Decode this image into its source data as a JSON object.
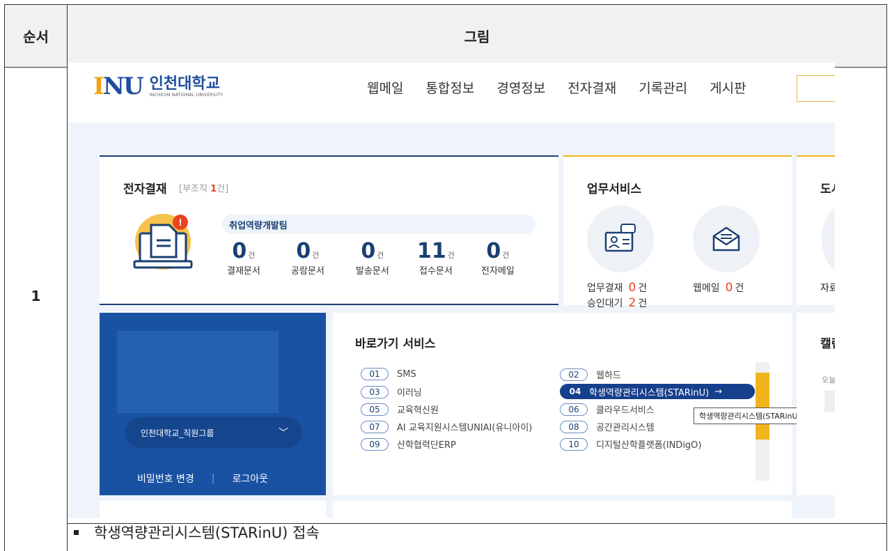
{
  "doc": {
    "header_order": "순서",
    "header_figure": "그림",
    "row_number": "1",
    "caption": "학생역량관리시스템(STARinU) 접속"
  },
  "site": {
    "logo_mark": "INU",
    "logo_ko": "인천대학교",
    "logo_en": "INCHEON NATIONAL UNIVERSITY",
    "nav": [
      "웹메일",
      "통합정보",
      "경영정보",
      "전자결재",
      "기록관리",
      "게시판"
    ]
  },
  "approval": {
    "title": "전자결재",
    "sub_prefix": "[부조직 ",
    "sub_count": "1",
    "sub_suffix": "건]",
    "team": "취업역량개발팀",
    "unit": "건",
    "stats": [
      {
        "value": "0",
        "label": "결재문서"
      },
      {
        "value": "0",
        "label": "공람문서"
      },
      {
        "value": "0",
        "label": "발송문서"
      },
      {
        "value": "11",
        "label": "접수문서"
      },
      {
        "value": "0",
        "label": "전자메일"
      }
    ]
  },
  "biz": {
    "title": "업무서비스",
    "line1_label": "업무결재",
    "line1_value": "0",
    "line2_label": "승인대기",
    "line2_value": "2",
    "mail_label": "웹메일",
    "mail_value": "0",
    "unit": "건"
  },
  "library": {
    "title": "도서",
    "label": "자료"
  },
  "user": {
    "group": "인천대학교_직원그룹",
    "change_pw": "비밀번호 변경",
    "logout": "로그아웃"
  },
  "quick": {
    "title": "바로가기 서비스",
    "items": [
      {
        "num": "01",
        "label": "SMS"
      },
      {
        "num": "02",
        "label": "웹하드"
      },
      {
        "num": "03",
        "label": "이러닝"
      },
      {
        "num": "04",
        "label": "학생역량관리시스템(STARinU)"
      },
      {
        "num": "05",
        "label": "교육혁신원"
      },
      {
        "num": "06",
        "label": "클라우드서비스"
      },
      {
        "num": "07",
        "label": "AI 교육지원시스템UNIAI(유니아이)"
      },
      {
        "num": "08",
        "label": "공간관리시스템"
      },
      {
        "num": "09",
        "label": "산학협력단ERP"
      },
      {
        "num": "10",
        "label": "디지털산학플랫폼(INDigO)"
      }
    ],
    "arrow": "→",
    "tooltip": "학생역량관리시스템(STARinU)"
  },
  "calendar": {
    "title": "캘린",
    "today": "오늘"
  },
  "colors": {
    "brand_blue": "#1a52a3",
    "accent_orange": "#f2b41c",
    "count_red": "#e8451e"
  }
}
